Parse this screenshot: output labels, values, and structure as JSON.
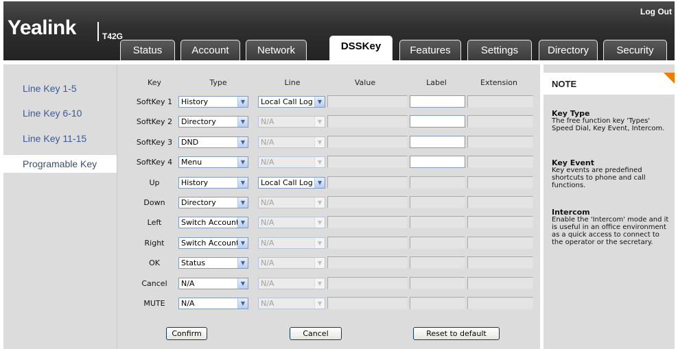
{
  "header": {
    "logo": "Yealink",
    "model": "T42G",
    "logout": "Log Out"
  },
  "tabs": [
    {
      "label": "Status"
    },
    {
      "label": "Account"
    },
    {
      "label": "Network"
    },
    {
      "label": "DSSKey"
    },
    {
      "label": "Features"
    },
    {
      "label": "Settings"
    },
    {
      "label": "Directory"
    },
    {
      "label": "Security"
    }
  ],
  "sidebar": {
    "items": [
      {
        "label": "Line Key 1-5"
      },
      {
        "label": "Line Key 6-10"
      },
      {
        "label": "Line Key 11-15"
      },
      {
        "label": "Programable Key"
      }
    ]
  },
  "table": {
    "headers": [
      "Key",
      "Type",
      "Line",
      "Value",
      "Label",
      "Extension"
    ],
    "rows": [
      {
        "key": "SoftKey 1",
        "type": "History",
        "line": "Local Call Log",
        "line_enabled": true,
        "label_enabled": true
      },
      {
        "key": "SoftKey 2",
        "type": "Directory",
        "line": "N/A",
        "line_enabled": false,
        "label_enabled": true
      },
      {
        "key": "SoftKey 3",
        "type": "DND",
        "line": "N/A",
        "line_enabled": false,
        "label_enabled": true
      },
      {
        "key": "SoftKey 4",
        "type": "Menu",
        "line": "N/A",
        "line_enabled": false,
        "label_enabled": true
      },
      {
        "key": "Up",
        "type": "History",
        "line": "Local Call Log",
        "line_enabled": true,
        "label_enabled": false
      },
      {
        "key": "Down",
        "type": "Directory",
        "line": "N/A",
        "line_enabled": false,
        "label_enabled": false
      },
      {
        "key": "Left",
        "type": "Switch Account",
        "line": "N/A",
        "line_enabled": false,
        "label_enabled": false
      },
      {
        "key": "Right",
        "type": "Switch Account",
        "line": "N/A",
        "line_enabled": false,
        "label_enabled": false
      },
      {
        "key": "OK",
        "type": "Status",
        "line": "N/A",
        "line_enabled": false,
        "label_enabled": false
      },
      {
        "key": "Cancel",
        "type": "N/A",
        "line": "N/A",
        "line_enabled": false,
        "label_enabled": false
      },
      {
        "key": "MUTE",
        "type": "N/A",
        "line": "N/A",
        "line_enabled": false,
        "label_enabled": false
      }
    ]
  },
  "buttons": {
    "confirm": "Confirm",
    "cancel": "Cancel",
    "reset": "Reset to default"
  },
  "note": {
    "title": "NOTE",
    "sections": [
      {
        "heading": "Key Type",
        "text": "The free function key 'Types' Speed Dial, Key Event, Intercom."
      },
      {
        "heading": "Key Event",
        "text": "Key events are predefined shortcuts to phone and call functions."
      },
      {
        "heading": "Intercom",
        "text": "Enable the 'Intercom' mode and it is useful in an office environment as a quick access to connect to the operator or the secretary."
      }
    ]
  },
  "colors": {
    "accent": "#f07c00",
    "header_bg": "#2f2f2f",
    "panel_bg": "#dcdcdc",
    "link": "#3a5a9a"
  }
}
